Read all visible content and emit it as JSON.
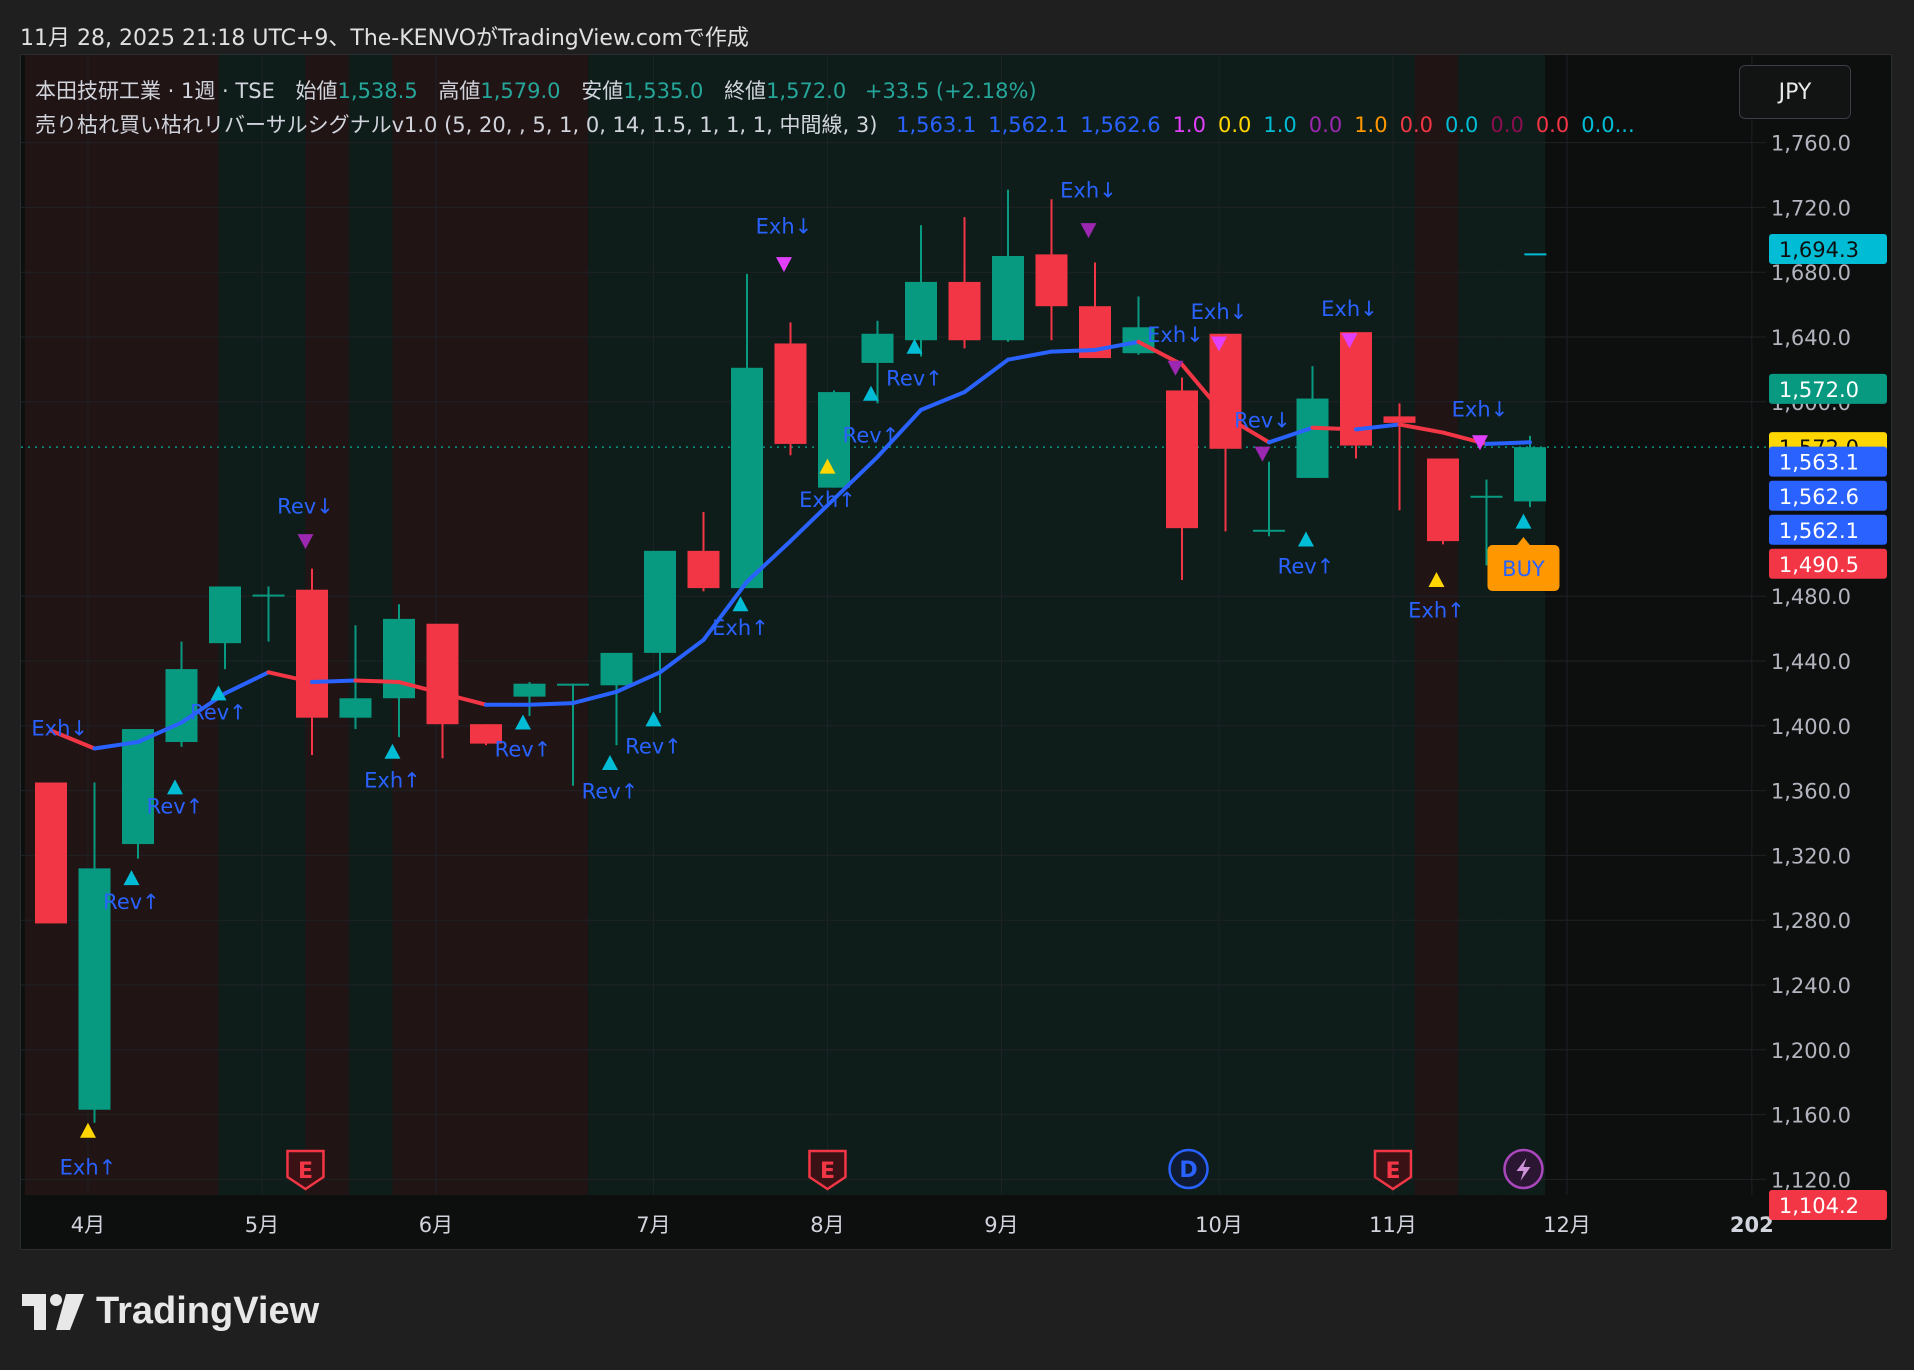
{
  "caption": "11月 28, 2025 21:18 UTC+9、The-KENVOがTradingView.comで作成",
  "brand": "TradingView",
  "currency_button": "JPY",
  "legend": {
    "symbol": "本田技研工業 · 1週 · TSE",
    "open_label": "始値",
    "open": "1,538.5",
    "high_label": "高値",
    "high": "1,579.0",
    "low_label": "安値",
    "low": "1,535.0",
    "close_label": "終値",
    "close": "1,572.0",
    "change": "+33.5 (+2.18%)",
    "indicator": "売り枯れ買い枯れリバーサルシグナルv1.0 (5, 20, , 5, 1, 0, 14, 1.5, 1, 1, 1, 中間線, 3)",
    "indicator_values": [
      {
        "text": "1,563.1",
        "color": "#2962ff"
      },
      {
        "text": "1,562.1",
        "color": "#2962ff"
      },
      {
        "text": "1,562.6",
        "color": "#2962ff"
      },
      {
        "text": "1.0",
        "color": "#e040fb"
      },
      {
        "text": "0.0",
        "color": "#ffd600"
      },
      {
        "text": "1.0",
        "color": "#00bcd4"
      },
      {
        "text": "0.0",
        "color": "#9c27b0"
      },
      {
        "text": "1.0",
        "color": "#ff9800"
      },
      {
        "text": "0.0",
        "color": "#f23645"
      },
      {
        "text": "0.0",
        "color": "#00bcd4"
      },
      {
        "text": "0.0",
        "color": "#880e4f"
      },
      {
        "text": "0.0",
        "color": "#f23645"
      },
      {
        "text": "0.0...",
        "color": "#00bcd4"
      }
    ]
  },
  "colors": {
    "up": "#089981",
    "down": "#f23645",
    "ma_up": "#2962ff",
    "ma_down": "#f23645",
    "bg_bull": "#0e1d1a",
    "bg_bear": "#201414",
    "signal_text": "#2962ff",
    "tri_cyan": "#00bcd4",
    "tri_yellow": "#ffd600",
    "tri_magenta": "#e040fb",
    "tri_purple": "#9c27b0"
  },
  "chart_data": {
    "type": "candlestick",
    "ylim": [
      1100,
      1740
    ],
    "y_ticks": [
      {
        "v": 1120,
        "t": "1,120.0"
      },
      {
        "v": 1160,
        "t": "1,160.0"
      },
      {
        "v": 1200,
        "t": "1,200.0"
      },
      {
        "v": 1240,
        "t": "1,240.0"
      },
      {
        "v": 1280,
        "t": "1,280.0"
      },
      {
        "v": 1320,
        "t": "1,320.0"
      },
      {
        "v": 1360,
        "t": "1,360.0"
      },
      {
        "v": 1400,
        "t": "1,400.0"
      },
      {
        "v": 1440,
        "t": "1,440.0"
      },
      {
        "v": 1480,
        "t": "1,480.0"
      },
      {
        "v": 1600,
        "t": "1,600.0"
      },
      {
        "v": 1640,
        "t": "1,640.0"
      },
      {
        "v": 1680,
        "t": "1,680.0"
      },
      {
        "v": 1720,
        "t": "1,720.0"
      },
      {
        "v": 1760,
        "t": "1,760.0"
      }
    ],
    "x_ticks": [
      {
        "i": 0.85,
        "t": "4月"
      },
      {
        "i": 4.85,
        "t": "5月"
      },
      {
        "i": 8.85,
        "t": "6月"
      },
      {
        "i": 13.85,
        "t": "7月"
      },
      {
        "i": 17.85,
        "t": "8月"
      },
      {
        "i": 21.85,
        "t": "9月"
      },
      {
        "i": 26.85,
        "t": "10月"
      },
      {
        "i": 30.85,
        "t": "11月"
      },
      {
        "i": 34.85,
        "t": "12月"
      },
      {
        "i": 39.1,
        "t": "202"
      }
    ],
    "candles": [
      {
        "o": 1365,
        "h": 1365,
        "l": 1278,
        "c": 1278
      },
      {
        "o": 1163,
        "h": 1365,
        "l": 1155,
        "c": 1312
      },
      {
        "o": 1327,
        "h": 1397,
        "l": 1318,
        "c": 1398
      },
      {
        "o": 1390,
        "h": 1452,
        "l": 1387,
        "c": 1435
      },
      {
        "o": 1451,
        "h": 1466,
        "l": 1435,
        "c": 1486
      },
      {
        "o": 1481,
        "h": 1486,
        "l": 1452,
        "c": 1481
      },
      {
        "o": 1484,
        "h": 1497,
        "l": 1382,
        "c": 1405
      },
      {
        "o": 1405,
        "h": 1462,
        "l": 1398,
        "c": 1417
      },
      {
        "o": 1417,
        "h": 1475,
        "l": 1393,
        "c": 1466
      },
      {
        "o": 1463,
        "h": 1463,
        "l": 1380,
        "c": 1401
      },
      {
        "o": 1401,
        "h": 1401,
        "l": 1388,
        "c": 1389
      },
      {
        "o": 1418,
        "h": 1427,
        "l": 1406,
        "c": 1426
      },
      {
        "o": 1426,
        "h": 1426,
        "l": 1363,
        "c": 1426
      },
      {
        "o": 1425,
        "h": 1439,
        "l": 1388,
        "c": 1445
      },
      {
        "o": 1445,
        "h": 1503,
        "l": 1408,
        "c": 1508
      },
      {
        "o": 1508,
        "h": 1532,
        "l": 1483,
        "c": 1485
      },
      {
        "o": 1485,
        "h": 1679,
        "l": 1485,
        "c": 1621
      },
      {
        "o": 1636,
        "h": 1649,
        "l": 1567,
        "c": 1574
      },
      {
        "o": 1547,
        "h": 1607,
        "l": 1547,
        "c": 1606
      },
      {
        "o": 1624,
        "h": 1650,
        "l": 1599,
        "c": 1642
      },
      {
        "o": 1638,
        "h": 1709,
        "l": 1628,
        "c": 1674
      },
      {
        "o": 1674,
        "h": 1714,
        "l": 1633,
        "c": 1638
      },
      {
        "o": 1638,
        "h": 1731,
        "l": 1637,
        "c": 1690
      },
      {
        "o": 1691,
        "h": 1725,
        "l": 1638,
        "c": 1659
      },
      {
        "o": 1659,
        "h": 1686,
        "l": 1630,
        "c": 1627
      },
      {
        "o": 1630,
        "h": 1665,
        "l": 1629,
        "c": 1646
      },
      {
        "o": 1607,
        "h": 1615,
        "l": 1490,
        "c": 1522
      },
      {
        "o": 1642,
        "h": 1642,
        "l": 1520,
        "c": 1571
      },
      {
        "o": 1521,
        "h": 1563,
        "l": 1517,
        "c": 1521
      },
      {
        "o": 1553,
        "h": 1622,
        "l": 1553,
        "c": 1602
      },
      {
        "o": 1643,
        "h": 1643,
        "l": 1565,
        "c": 1573
      },
      {
        "o": 1591,
        "h": 1599,
        "l": 1533,
        "c": 1587
      },
      {
        "o": 1565,
        "h": 1565,
        "l": 1512,
        "c": 1514
      },
      {
        "o": 1542,
        "h": 1552,
        "l": 1499,
        "c": 1542
      },
      {
        "o": 1538.5,
        "h": 1579,
        "l": 1535,
        "c": 1572
      }
    ],
    "ma": [
      1397,
      1386,
      1390,
      1402,
      1420,
      1433,
      1427,
      1428,
      1427,
      1420,
      1413,
      1413,
      1414,
      1421,
      1433,
      1453,
      1489,
      1514,
      1540,
      1566,
      1595,
      1606,
      1626,
      1631,
      1632,
      1637,
      1623,
      1591,
      1575,
      1584,
      1583,
      1586,
      1581,
      1574,
      1575
    ],
    "signals": [
      {
        "i": 0.2,
        "kind": "label",
        "text": "Exh↓",
        "y": 1394
      },
      {
        "i": 0.85,
        "kind": "tri_up",
        "color": "tri_yellow",
        "y": 1150
      },
      {
        "i": 0.85,
        "kind": "label",
        "text": "Exh↑",
        "y": 1123
      },
      {
        "i": 1.85,
        "kind": "tri_up",
        "color": "tri_cyan",
        "y": 1306
      },
      {
        "i": 1.85,
        "kind": "label",
        "text": "Rev↑",
        "y": 1287
      },
      {
        "i": 2.85,
        "kind": "tri_up",
        "color": "tri_cyan",
        "y": 1362
      },
      {
        "i": 2.85,
        "kind": "label",
        "text": "Rev↑",
        "y": 1346
      },
      {
        "i": 3.85,
        "kind": "tri_up",
        "color": "tri_cyan",
        "y": 1420
      },
      {
        "i": 3.85,
        "kind": "label",
        "text": "Rev↑",
        "y": 1404
      },
      {
        "i": 5.85,
        "kind": "label",
        "text": "Rev↓",
        "y": 1531
      },
      {
        "i": 5.85,
        "kind": "tri_down",
        "color": "tri_purple",
        "y": 1514
      },
      {
        "i": 7.85,
        "kind": "tri_up",
        "color": "tri_cyan",
        "y": 1384
      },
      {
        "i": 7.85,
        "kind": "label",
        "text": "Exh↑",
        "y": 1362
      },
      {
        "i": 10.85,
        "kind": "tri_up",
        "color": "tri_cyan",
        "y": 1402
      },
      {
        "i": 10.85,
        "kind": "label",
        "text": "Rev↑",
        "y": 1381
      },
      {
        "i": 12.85,
        "kind": "tri_up",
        "color": "tri_cyan",
        "y": 1377
      },
      {
        "i": 12.85,
        "kind": "label",
        "text": "Rev↑",
        "y": 1355
      },
      {
        "i": 13.85,
        "kind": "tri_up",
        "color": "tri_cyan",
        "y": 1404
      },
      {
        "i": 13.85,
        "kind": "label",
        "text": "Rev↑",
        "y": 1383
      },
      {
        "i": 15.85,
        "kind": "tri_up",
        "color": "tri_cyan",
        "y": 1475
      },
      {
        "i": 15.85,
        "kind": "label",
        "text": "Exh↑",
        "y": 1456
      },
      {
        "i": 16.85,
        "kind": "label",
        "text": "Exh↓",
        "y": 1704
      },
      {
        "i": 16.85,
        "kind": "tri_down",
        "color": "tri_magenta",
        "y": 1685
      },
      {
        "i": 17.85,
        "kind": "tri_up",
        "color": "tri_yellow",
        "y": 1560
      },
      {
        "i": 17.85,
        "kind": "label",
        "text": "Exh↑",
        "y": 1535
      },
      {
        "i": 18.85,
        "kind": "tri_up",
        "color": "tri_cyan",
        "y": 1605
      },
      {
        "i": 18.85,
        "kind": "label",
        "text": "Rev↑",
        "y": 1575
      },
      {
        "i": 19.85,
        "kind": "tri_up",
        "color": "tri_cyan",
        "y": 1634
      },
      {
        "i": 19.85,
        "kind": "label",
        "text": "Rev↑",
        "y": 1610
      },
      {
        "i": 23.85,
        "kind": "label",
        "text": "Exh↓",
        "y": 1726
      },
      {
        "i": 23.85,
        "kind": "tri_down",
        "color": "tri_purple",
        "y": 1706
      },
      {
        "i": 25.85,
        "kind": "label",
        "text": "Exh↓",
        "y": 1637
      },
      {
        "i": 25.85,
        "kind": "tri_down",
        "color": "tri_purple",
        "y": 1621
      },
      {
        "i": 26.85,
        "kind": "label",
        "text": "Exh↓",
        "y": 1651
      },
      {
        "i": 26.85,
        "kind": "tri_down",
        "color": "tri_magenta",
        "y": 1636
      },
      {
        "i": 27.85,
        "kind": "label",
        "text": "Rev↓",
        "y": 1584
      },
      {
        "i": 27.85,
        "kind": "tri_down",
        "color": "tri_purple",
        "y": 1568
      },
      {
        "i": 28.85,
        "kind": "tri_up",
        "color": "tri_cyan",
        "y": 1515
      },
      {
        "i": 28.85,
        "kind": "label",
        "text": "Rev↑",
        "y": 1494
      },
      {
        "i": 29.85,
        "kind": "label",
        "text": "Exh↓",
        "y": 1653
      },
      {
        "i": 29.85,
        "kind": "tri_down",
        "color": "tri_magenta",
        "y": 1638
      },
      {
        "i": 31.85,
        "kind": "tri_up",
        "color": "tri_yellow",
        "y": 1490
      },
      {
        "i": 31.85,
        "kind": "label",
        "text": "Exh↑",
        "y": 1467
      },
      {
        "i": 32.85,
        "kind": "label",
        "text": "Exh↓",
        "y": 1591
      },
      {
        "i": 32.85,
        "kind": "tri_down",
        "color": "tri_magenta",
        "y": 1575
      },
      {
        "i": 33.85,
        "kind": "tri_up",
        "color": "tri_cyan",
        "y": 1526
      }
    ],
    "buy_marker": {
      "i": 33.85,
      "y": 1498,
      "text": "BUY"
    },
    "last_price_line": 1572,
    "target_tick": {
      "i": 34.1,
      "y": 1691
    },
    "events": [
      {
        "i": 5.85,
        "t": "E"
      },
      {
        "i": 17.85,
        "t": "E"
      },
      {
        "i": 26.15,
        "t": "D"
      },
      {
        "i": 30.85,
        "t": "E"
      },
      {
        "i": 33.85,
        "t": "⚡"
      }
    ],
    "price_labels": [
      {
        "v": 1694.3,
        "t": "1,694.3",
        "bg": "#00bcd4",
        "fg": "#0d0f0f"
      },
      {
        "v": 1608,
        "t": "1,572.0",
        "bg": "#089981",
        "fg": "#ffffff"
      },
      {
        "v": 1572,
        "t": "1,572.0",
        "bg": "#ffd600",
        "fg": "#0d0f0f"
      },
      {
        "v": 1563.1,
        "t": "1,563.1",
        "bg": "#2962ff",
        "fg": "#ffffff"
      },
      {
        "v": 1542,
        "t": "1,562.6",
        "bg": "#2962ff",
        "fg": "#ffffff"
      },
      {
        "v": 1521,
        "t": "1,562.1",
        "bg": "#2962ff",
        "fg": "#ffffff"
      },
      {
        "v": 1500,
        "t": "1,490.5",
        "bg": "#f23645",
        "fg": "#ffffff"
      },
      {
        "v": 1104.2,
        "t": "1,104.2",
        "bg": "#f23645",
        "fg": "#ffffff"
      }
    ],
    "bg_segments": [
      {
        "s": -0.6,
        "e": 3.85,
        "kind": "bear"
      },
      {
        "s": 3.85,
        "e": 5.85,
        "kind": "bull"
      },
      {
        "s": 5.85,
        "e": 6.85,
        "kind": "bear"
      },
      {
        "s": 6.85,
        "e": 7.85,
        "kind": "bull"
      },
      {
        "s": 7.85,
        "e": 12.35,
        "kind": "bear"
      },
      {
        "s": 12.35,
        "e": 31.35,
        "kind": "bull"
      },
      {
        "s": 31.35,
        "e": 32.35,
        "kind": "bear"
      },
      {
        "s": 32.35,
        "e": 33.35,
        "kind": "bull"
      },
      {
        "s": 33.35,
        "e": 34.35,
        "kind": "bull"
      }
    ]
  }
}
